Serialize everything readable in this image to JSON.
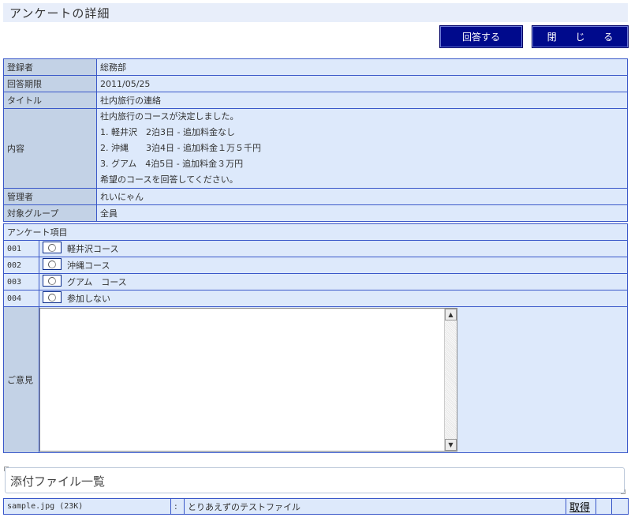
{
  "page": {
    "title": "アンケートの詳細"
  },
  "buttons": {
    "answer": "回答する",
    "close": "閉 じ る"
  },
  "info": {
    "registrant": {
      "label": "登録者",
      "value": "総務部"
    },
    "deadline": {
      "label": "回答期限",
      "value": "2011/05/25"
    },
    "title": {
      "label": "タイトル",
      "value": "社内旅行の連絡"
    },
    "content": {
      "label": "内容",
      "lines": [
        "社内旅行のコースが決定しました。",
        "1. 軽井沢　2泊3日 - 追加料金なし",
        "2. 沖縄　　3泊4日 - 追加料金１万５千円",
        "3. グアム　4泊5日 - 追加料金３万円",
        "希望のコースを回答してください。"
      ]
    },
    "manager": {
      "label": "管理者",
      "value": "れいにゃん"
    },
    "group": {
      "label": "対象グループ",
      "value": "全員"
    }
  },
  "survey": {
    "header": "アンケート項目",
    "items": [
      {
        "num": "001",
        "label": "軽井沢コース"
      },
      {
        "num": "002",
        "label": "沖縄コース"
      },
      {
        "num": "003",
        "label": "グアム　コース"
      },
      {
        "num": "004",
        "label": "参加しない"
      }
    ],
    "opinion_label": "ご意見"
  },
  "attachments": {
    "title": "添付ファイル一覧",
    "files": [
      {
        "name": "sample.jpg (23K)",
        "sep": ":",
        "desc": "とりあえずのテストファイル",
        "action": "取得"
      }
    ]
  }
}
